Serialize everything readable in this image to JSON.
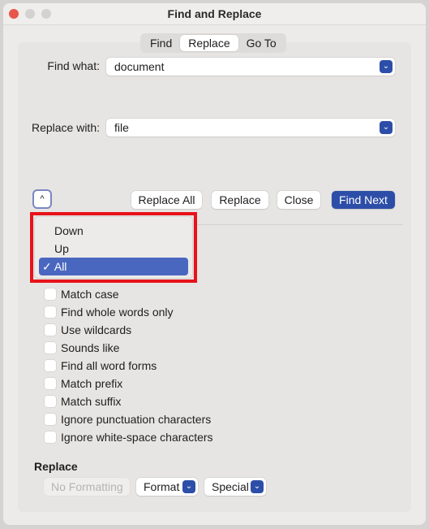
{
  "window": {
    "title": "Find and Replace"
  },
  "tabs": [
    {
      "label": "Find"
    },
    {
      "label": "Replace",
      "active": true
    },
    {
      "label": "Go To"
    }
  ],
  "find": {
    "label": "Find what:",
    "value": "document"
  },
  "replace": {
    "label": "Replace with:",
    "value": "file"
  },
  "buttons": {
    "replace_all": "Replace All",
    "replace": "Replace",
    "close": "Close",
    "find_next": "Find Next"
  },
  "search_menu": {
    "items": [
      {
        "label": "Down"
      },
      {
        "label": "Up"
      },
      {
        "label": "All",
        "selected": true
      }
    ],
    "check": "✓"
  },
  "options": [
    {
      "label": "Match case",
      "checked": false
    },
    {
      "label": "Find whole words only",
      "checked": false
    },
    {
      "label": "Use wildcards",
      "checked": false
    },
    {
      "label": "Sounds like",
      "checked": false
    },
    {
      "label": "Find all word forms",
      "checked": false
    },
    {
      "label": "Match prefix",
      "checked": false
    },
    {
      "label": "Match suffix",
      "checked": false
    },
    {
      "label": "Ignore punctuation characters",
      "checked": false
    },
    {
      "label": "Ignore white-space characters",
      "checked": false
    }
  ],
  "replace_section": {
    "heading": "Replace",
    "no_formatting": "No Formatting",
    "format": "Format",
    "special": "Special"
  },
  "colors": {
    "accent": "#2d4ea8",
    "highlight": "#4a67c0",
    "annotation": "#e8121a",
    "close": "#e9554b"
  }
}
